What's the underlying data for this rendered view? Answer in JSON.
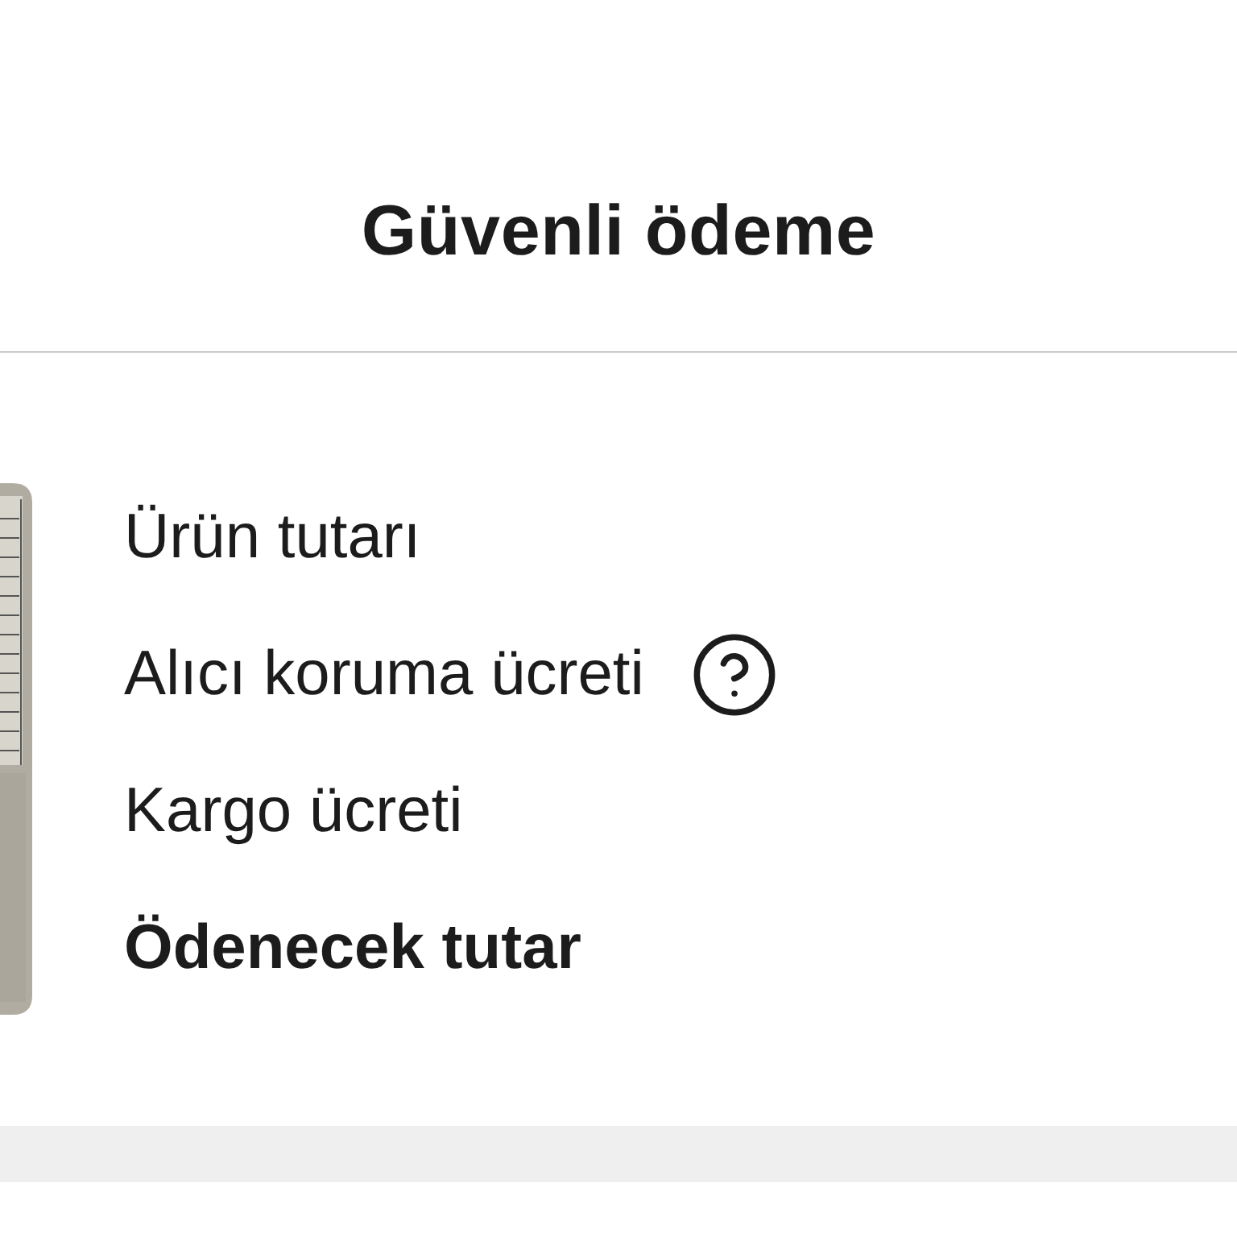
{
  "title": "Güvenli ödeme",
  "summary_rows": [
    {
      "label": "Ürün tutarı",
      "kind": "plain"
    },
    {
      "label": "Alıcı koruma ücreti",
      "kind": "help"
    },
    {
      "label": "Kargo ücreti",
      "kind": "plain"
    },
    {
      "label": "Ödenecek tutar",
      "kind": "total"
    }
  ]
}
